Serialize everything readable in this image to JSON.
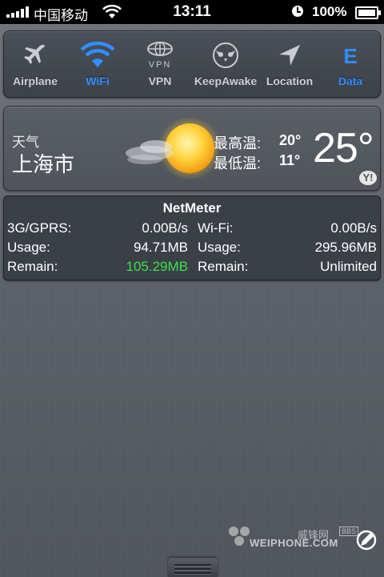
{
  "status_bar": {
    "carrier": "中国移动",
    "time": "13:11",
    "battery": "100%"
  },
  "toggles": [
    {
      "label": "Airplane",
      "icon": "airplane-icon",
      "on": false
    },
    {
      "label": "WiFi",
      "icon": "wifi-icon",
      "on": true
    },
    {
      "label": "VPN",
      "icon": "vpn-icon",
      "on": false
    },
    {
      "label": "KeepAwake",
      "icon": "owl-icon",
      "on": false
    },
    {
      "label": "Location",
      "icon": "location-icon",
      "on": false
    },
    {
      "label": "Data",
      "icon": "data-e-icon",
      "on": true
    }
  ],
  "weather": {
    "label": "天气",
    "city": "上海市",
    "high_label": "最高温:",
    "low_label": "最低温:",
    "high": "20°",
    "low": "11°",
    "current": "25°",
    "provider_badge": "Y!"
  },
  "netmeter": {
    "title": "NetMeter",
    "rows": [
      {
        "l1": "3G/GPRS:",
        "v1": "0.00B/s",
        "l2": "Wi-Fi:",
        "v2": "0.00B/s"
      },
      {
        "l1": "Usage:",
        "v1": "94.71MB",
        "l2": "Usage:",
        "v2": "295.96MB"
      },
      {
        "l1": "Remain:",
        "v1": "105.29MB",
        "l2": "Remain:",
        "v2": "Unlimited"
      }
    ],
    "highlight_color": "#39e24a"
  },
  "watermark": {
    "cn": "威锋网",
    "bbs": "BBS",
    "en": "WEIPHONE.COM"
  },
  "colors": {
    "accent_on": "#2f8fff",
    "label_off": "#cfd2d6"
  }
}
